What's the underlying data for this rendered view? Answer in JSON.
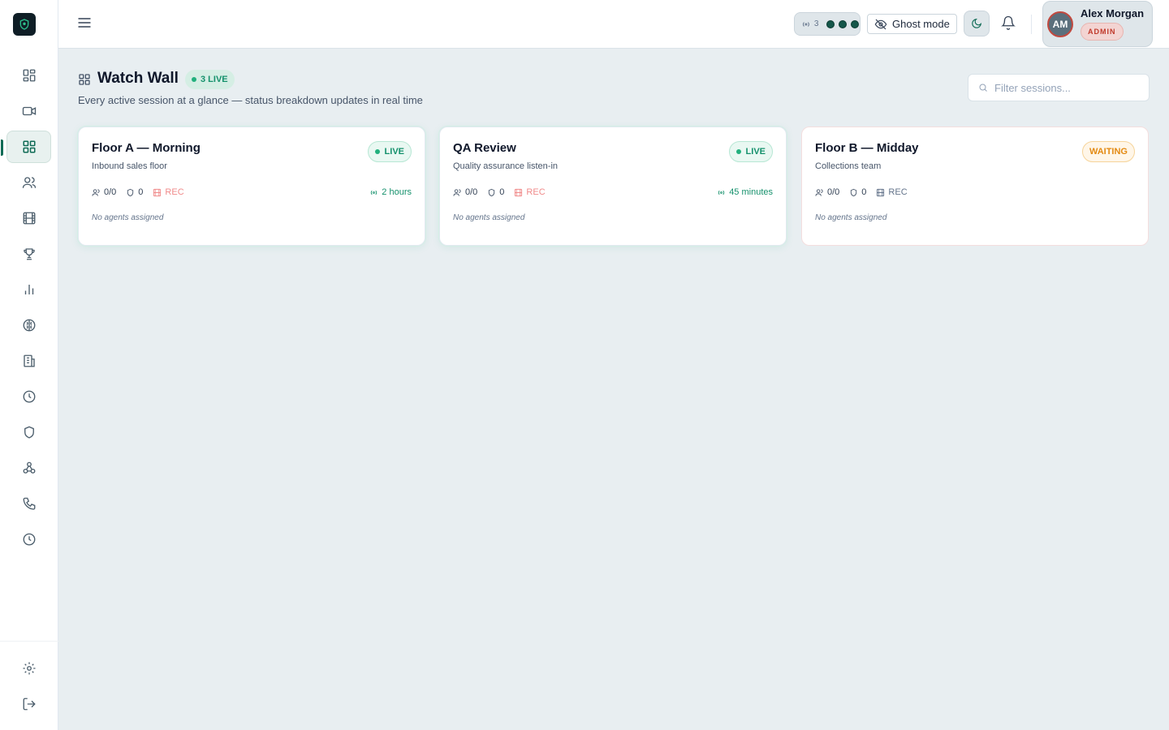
{
  "sidebar": {
    "items": [
      {
        "icon": "dashboard-icon",
        "active": false
      },
      {
        "icon": "video-icon",
        "active": false
      },
      {
        "icon": "grid-icon",
        "active": true
      },
      {
        "icon": "users-icon",
        "active": false
      },
      {
        "icon": "film-icon",
        "active": false
      },
      {
        "icon": "trophy-icon",
        "active": false
      },
      {
        "icon": "bar-chart-icon",
        "active": false
      },
      {
        "icon": "brain-icon",
        "active": false
      },
      {
        "icon": "building-icon",
        "active": false
      },
      {
        "icon": "clock-icon",
        "active": false
      },
      {
        "icon": "shield-icon",
        "active": false
      },
      {
        "icon": "webhook-icon",
        "active": false
      },
      {
        "icon": "phone-icon",
        "active": false
      },
      {
        "icon": "history-icon",
        "active": false
      }
    ],
    "bottom": [
      {
        "icon": "gear-icon"
      },
      {
        "icon": "logout-icon"
      }
    ]
  },
  "topbar": {
    "presence_count": "3",
    "ghost_mode_label": "Ghost mode",
    "user": {
      "initials": "AM",
      "name": "Alex Morgan",
      "role": "ADMIN"
    }
  },
  "header": {
    "title": "Watch Wall",
    "live_count": "3 LIVE",
    "subtitle": "Every active session at a glance — status breakdown updates in real time",
    "filter_placeholder": "Filter sessions..."
  },
  "sessions": [
    {
      "title": "Floor A — Morning",
      "description": "Inbound sales floor",
      "status": "LIVE",
      "agents": "0/0",
      "flags": "0",
      "rec": "REC",
      "duration": "2 hours",
      "assignment": "No agents assigned"
    },
    {
      "title": "QA Review",
      "description": "Quality assurance listen-in",
      "status": "LIVE",
      "agents": "0/0",
      "flags": "0",
      "rec": "REC",
      "duration": "45 minutes",
      "assignment": "No agents assigned"
    },
    {
      "title": "Floor B — Midday",
      "description": "Collections team",
      "status": "WAITING",
      "agents": "0/0",
      "flags": "0",
      "rec": "REC",
      "duration": "",
      "assignment": "No agents assigned"
    }
  ],
  "colors": {
    "accent": "#0f6b55",
    "live": "#15916c",
    "waiting": "#e38a12",
    "admin": "#c0392b",
    "background": "#e8eef1"
  }
}
